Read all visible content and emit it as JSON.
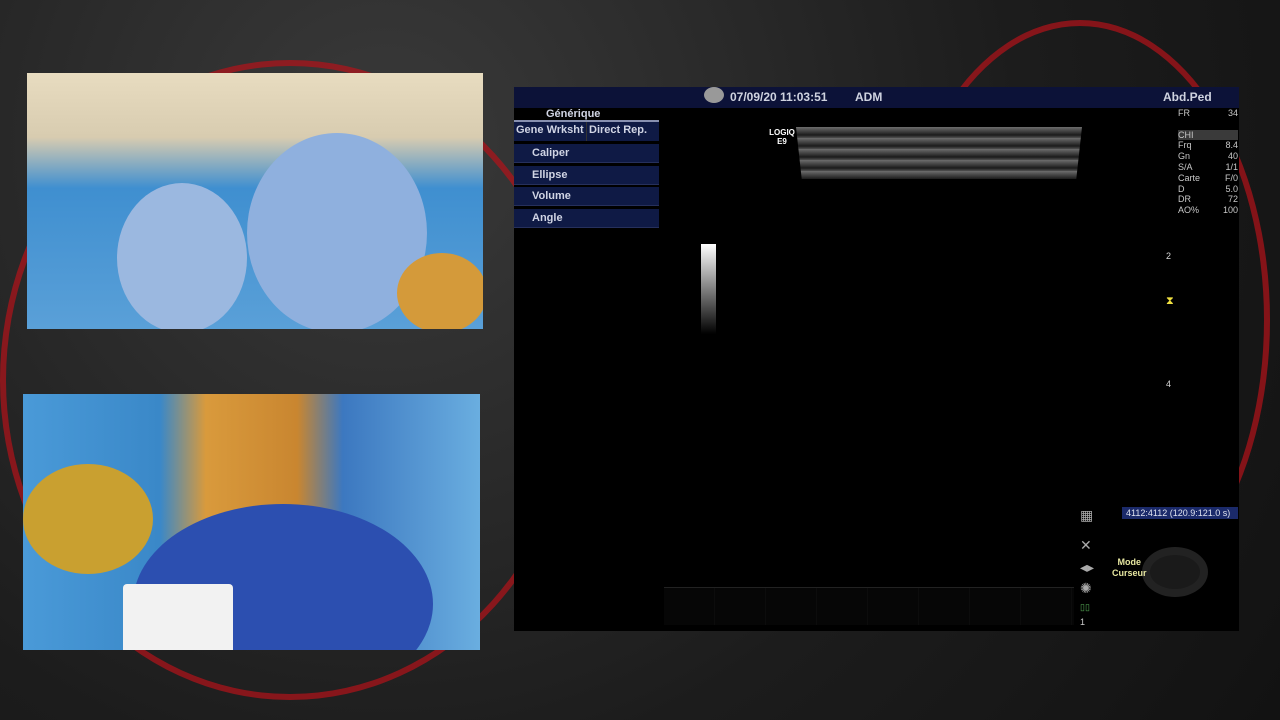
{
  "ultrasound": {
    "datetime": "07/09/20 11:03:51",
    "operator": "ADM",
    "preset": "Abd.Ped",
    "menu_header": "Générique",
    "tabs": [
      "Gene Wrksht",
      "Direct Rep."
    ],
    "menu_items": [
      "Caliper",
      "Ellipse",
      "Volume",
      "Angle"
    ],
    "probe_label": "LOGIQ E9",
    "params": [
      {
        "k": "FR",
        "v": "34"
      },
      {
        "k": "CHI",
        "v": ""
      },
      {
        "k": "Frq",
        "v": "8.4"
      },
      {
        "k": "Gn",
        "v": "40"
      },
      {
        "k": "S/A",
        "v": "1/1"
      },
      {
        "k": "Carte",
        "v": "F/0"
      },
      {
        "k": "D",
        "v": "5.0"
      },
      {
        "k": "DR",
        "v": "72"
      },
      {
        "k": "AO%",
        "v": "100"
      }
    ],
    "depth_marks": [
      "2",
      "4"
    ],
    "cine_readout": "4112:4112  (120.9:121.0 s)",
    "mode_label": "Mode",
    "cursor_label": "Curseur",
    "page_number": "1"
  }
}
